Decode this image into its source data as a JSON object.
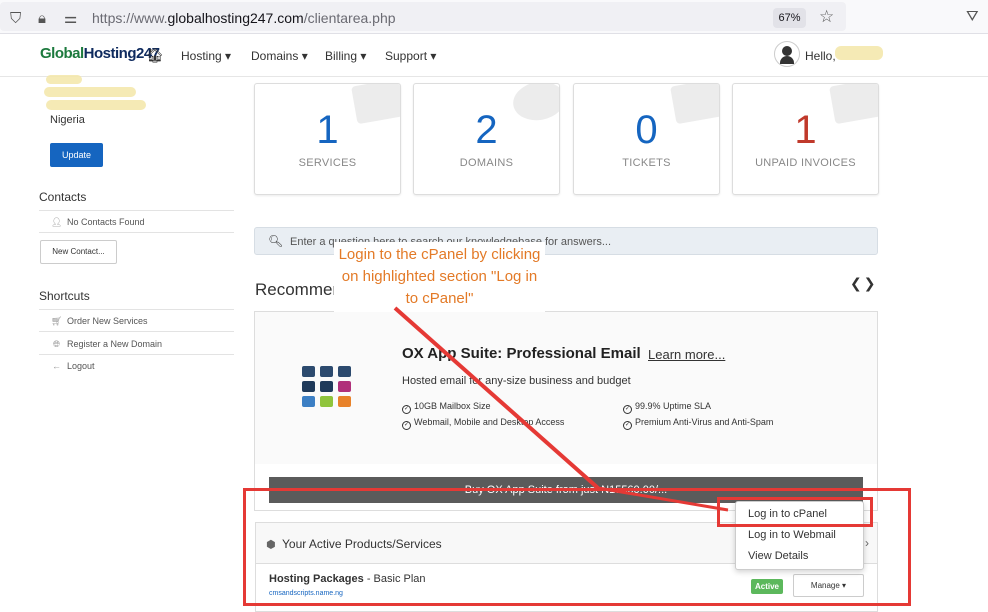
{
  "browser": {
    "url_prefix": "https://www.",
    "url_domain": "globalhosting247.com",
    "url_path": "/clientarea.php",
    "zoom": "67%"
  },
  "topnav": {
    "logo_part1": "Global",
    "logo_part2": "Hosting247",
    "items": [
      "Hosting",
      "Domains",
      "Billing",
      "Support"
    ],
    "hello": "Hello,"
  },
  "sidebar": {
    "country": "Nigeria",
    "update_button": "Update",
    "contacts_heading": "Contacts",
    "no_contacts": "No Contacts Found",
    "new_contact_button": "New Contact...",
    "shortcuts_heading": "Shortcuts",
    "shortcuts": [
      "Order New Services",
      "Register a New Domain",
      "Logout"
    ]
  },
  "stats": [
    {
      "value": "1",
      "label": "SERVICES",
      "color": "#1565c0"
    },
    {
      "value": "2",
      "label": "DOMAINS",
      "color": "#1565c0"
    },
    {
      "value": "0",
      "label": "TICKETS",
      "color": "#1565c0"
    },
    {
      "value": "1",
      "label": "UNPAID INVOICES",
      "color": "#c0392b"
    }
  ],
  "search": {
    "placeholder": "Enter a question here to search our knowledgebase for answers..."
  },
  "recommended": {
    "heading": "Recommended",
    "product_title": "OX App Suite: Professional Email",
    "learn_more": "Learn more...",
    "subtitle": "Hosted email for any-size business and budget",
    "features": [
      "10GB Mailbox Size",
      "99.9% Uptime SLA",
      "Webmail, Mobile and Desktop Access",
      "Premium Anti-Virus and Anti-Spam"
    ],
    "buy_label": "Buy OX App Suite from just N15560.00/..."
  },
  "active_products": {
    "heading": "Your Active Products/Services",
    "product_name": "Hosting Packages",
    "product_plan": " - Basic Plan",
    "domain": "cmsandscripts.name.ng",
    "status": "Active",
    "manage_button": "Manage"
  },
  "dropdown": {
    "items": [
      "Log in to cPanel",
      "Log in to Webmail",
      "View Details"
    ]
  },
  "annotation": {
    "callout_text": "Login to the cPanel by clicking on highlighted section \"Log in to cPanel\"",
    "color": "#e53935",
    "text_color": "#e37a27"
  }
}
